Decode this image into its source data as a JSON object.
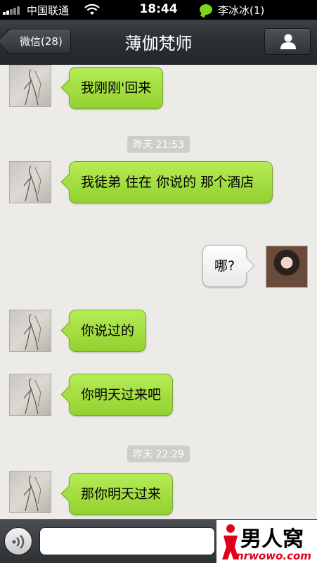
{
  "status_bar": {
    "carrier": "中国联通",
    "time": "18:44",
    "notification": "李冰冰(1)"
  },
  "nav": {
    "back_label": "微信(28)",
    "title": "薄伽梵师"
  },
  "messages": [
    {
      "side": "left",
      "text": "我刚刚'回来"
    },
    {
      "type": "timestamp",
      "text": "昨天 21:53"
    },
    {
      "side": "left",
      "text": "我徒弟  住在  你说的  那个酒店"
    },
    {
      "side": "right",
      "text": "哪?"
    },
    {
      "side": "left",
      "text": "你说过的"
    },
    {
      "side": "left",
      "text": "你明天过来吧"
    },
    {
      "type": "timestamp",
      "text": "昨天 22:29"
    },
    {
      "side": "left",
      "text": "那你明天过来"
    }
  ],
  "input": {
    "value": "",
    "placeholder": ""
  },
  "watermark": {
    "title": "男人窝",
    "url": "nrwowo.com"
  },
  "colors": {
    "bubble_green": "#a5de42",
    "nav_dark": "#2b2e31",
    "timestamp_bg": "#cfcdc8"
  }
}
